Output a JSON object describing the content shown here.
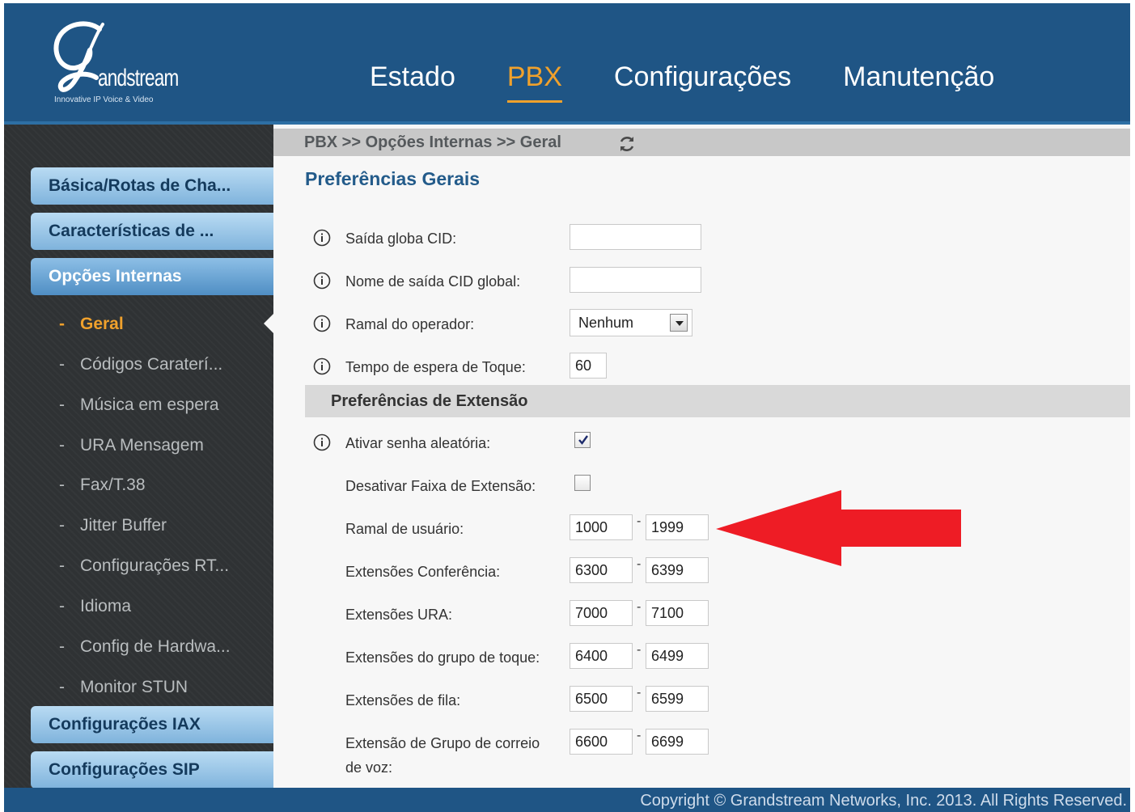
{
  "logo": {
    "wordmark": "andstream",
    "tagline": "Innovative IP Voice & Video"
  },
  "nav": [
    {
      "label": "Estado"
    },
    {
      "label": "PBX",
      "active": true
    },
    {
      "label": "Configurações"
    },
    {
      "label": "Manutenção"
    }
  ],
  "sidebar": {
    "groups": [
      {
        "label": "Básica/Rotas de Cha..."
      },
      {
        "label": "Características de ..."
      },
      {
        "label": "Opções Internas"
      },
      {
        "label": "Configurações IAX"
      },
      {
        "label": "Configurações SIP"
      }
    ],
    "sub_dash": "-",
    "sub_items": [
      {
        "label": "Geral",
        "active": true
      },
      {
        "label": "Códigos Caraterí..."
      },
      {
        "label": "Música em espera"
      },
      {
        "label": "URA Mensagem"
      },
      {
        "label": "Fax/T.38"
      },
      {
        "label": "Jitter Buffer"
      },
      {
        "label": "Configurações RT..."
      },
      {
        "label": "Idioma"
      },
      {
        "label": "Config de Hardwa..."
      },
      {
        "label": "Monitor STUN"
      }
    ]
  },
  "breadcrumb": "PBX >> Opções Internas >> Geral",
  "page_title": "Preferências Gerais",
  "general": {
    "global_cid": {
      "label": "Saída globa CID:",
      "value": ""
    },
    "global_cid_name": {
      "label": "Nome de saída CID global:",
      "value": ""
    },
    "operator": {
      "label": "Ramal do operador:",
      "value": "Nenhum"
    },
    "ring_timeout": {
      "label": "Tempo de espera de Toque:",
      "value": "60"
    }
  },
  "extension_section": {
    "title": "Preferências de Extensão",
    "random_password": {
      "label": "Ativar senha aleatória:",
      "checked": true
    },
    "disable_range": {
      "label": "Desativar Faixa de Extensão:",
      "checked": false
    },
    "range_sep": "-",
    "ranges": [
      {
        "label": "Ramal de usuário:",
        "from": "1000",
        "to": "1999"
      },
      {
        "label": "Extensões Conferência:",
        "from": "6300",
        "to": "6399"
      },
      {
        "label": "Extensões URA:",
        "from": "7000",
        "to": "7100"
      },
      {
        "label": "Extensões do grupo de toque:",
        "from": "6400",
        "to": "6499"
      },
      {
        "label": "Extensões de fila:",
        "from": "6500",
        "to": "6599"
      },
      {
        "label": "Extensão de Grupo de correio",
        "label2": "de voz:",
        "from": "6600",
        "to": "6699"
      }
    ]
  },
  "footer": "Copyright © Grandstream Networks, Inc. 2013. All Rights Reserved.",
  "colors": {
    "header": "#1f5585",
    "accent": "#f0a12c",
    "annotation_arrow": "#ee1c25"
  }
}
